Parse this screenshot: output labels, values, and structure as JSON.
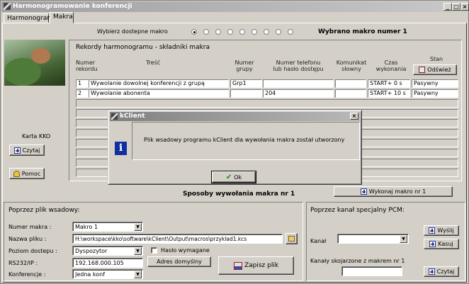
{
  "window": {
    "title": "Harmonogramowanie konferencji"
  },
  "tabs": [
    {
      "label": "Harmonogram"
    },
    {
      "label": "Makra"
    }
  ],
  "macro_select": {
    "label": "Wybierz dostepne makro",
    "selected_text": "Wybrano makro numer 1",
    "radio_count": 9,
    "selected_index": 0
  },
  "records": {
    "title": "Rekordy harmonogramu - składniki makra",
    "headers": {
      "numer": "Numer\nrekordu",
      "tresc": "Treść",
      "grupa": "Numer\ngrupy",
      "telefon": "Numer telefonu\nlub hasło dostępu",
      "komunikat": "Komunikat\nsłowny",
      "czas": "Czas\nwykonania",
      "stan": "Stan"
    },
    "refresh_label": "Odśwież",
    "rows": [
      {
        "num": "1",
        "tresc": "Wywolanie dowolnej konferencji z grupą",
        "grupa": "Grp1",
        "telefon": "",
        "komunikat": "",
        "czas": "START+ 0 s",
        "stan": "Pasywny"
      },
      {
        "num": "2",
        "tresc": "Wywolanie abonenta",
        "grupa": "",
        "telefon": "204",
        "komunikat": "",
        "czas": "START+ 10 s",
        "stan": "Pasywny"
      }
    ]
  },
  "left_panel": {
    "card_label": "Karta KKO",
    "read_label": "Czytaj",
    "help_label": "Pomoc"
  },
  "execute_button": "Wykonaj makro nr 1",
  "invocation_title": "Sposoby wywołania makra nr 1",
  "batch": {
    "title": "Poprzez plik wsadowy:",
    "macro_number_label": "Numer makra :",
    "macro_number_value": "Makro 1",
    "file_label": "Nazwa pliku :",
    "file_value": "H:\\workspace\\kko\\software\\kClient\\Output\\macros\\przyklad1.kcs",
    "access_label": "Poziom dostepu :",
    "access_value": "Dyspozytor",
    "password_label": "Hasło wymagane",
    "rs_label": "RS232/IP :",
    "rs_value": "192.168.000.105",
    "default_addr_label": "Adres domyślny",
    "conference_label": "Konferencje :",
    "conference_value": "Jedna konf",
    "save_label": "Zapisz plik"
  },
  "pcm": {
    "title": "Poprzez kanał specjalny PCM:",
    "send_label": "Wyślij",
    "delete_label": "Kasuj",
    "channel_label": "Kanał",
    "linked_label": "Kanały skojarzone z makrem nr 1",
    "read_label": "Czytaj"
  },
  "dialog": {
    "title": "kClient",
    "message": "Plik wsadowy programu kClient dla wywołania makra został utworzony",
    "ok_label": "Ok"
  }
}
